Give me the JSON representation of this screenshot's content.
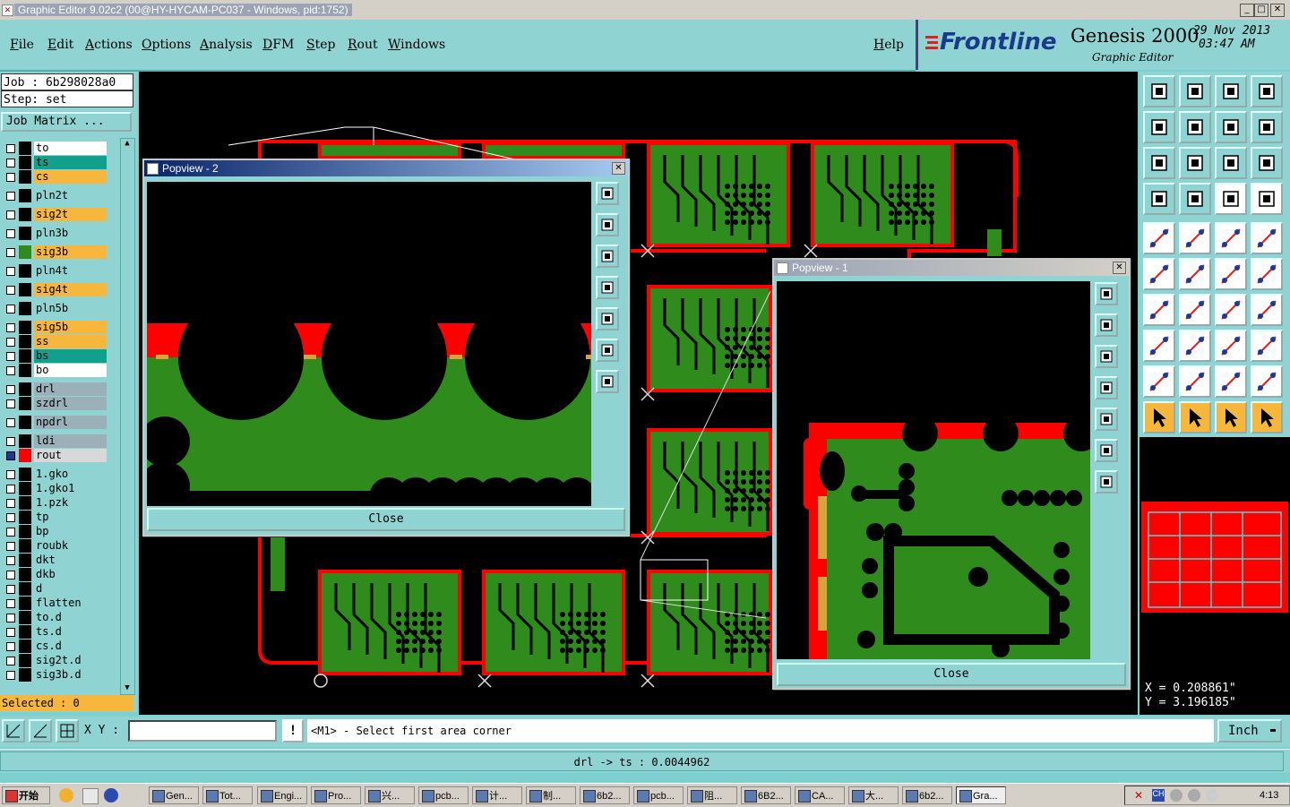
{
  "window": {
    "title": "Graphic Editor 9.02c2 (00@HY-HYCAM-PC037 - Windows, pid:1752)"
  },
  "menu": {
    "items": [
      "File",
      "Edit",
      "Actions",
      "Options",
      "Analysis",
      "DFM",
      "Step",
      "Rout",
      "Windows"
    ],
    "help": "Help"
  },
  "brand": {
    "logo": "Frontline",
    "product": "Genesis 2000",
    "subtitle": "Graphic Editor",
    "date": "29 Nov 2013",
    "time": "03:47 AM"
  },
  "job": {
    "job_label": "Job : 6b298028a0",
    "step_label": "Step: set",
    "matrix_button": "Job Matrix ..."
  },
  "layers": [
    {
      "name": "to",
      "color": "#ffffff"
    },
    {
      "name": "ts",
      "color": "#11a08c"
    },
    {
      "name": "cs",
      "color": "#f6b73c"
    },
    {
      "name": "pln2t",
      "color": "#8fd4d2"
    },
    {
      "name": "sig2t",
      "color": "#f6b73c"
    },
    {
      "name": "pln3b",
      "color": "#8fd4d2"
    },
    {
      "name": "sig3b",
      "color": "#f6b73c"
    },
    {
      "name": "pln4t",
      "color": "#8fd4d2"
    },
    {
      "name": "sig4t",
      "color": "#f6b73c"
    },
    {
      "name": "pln5b",
      "color": "#8fd4d2"
    },
    {
      "name": "sig5b",
      "color": "#f6b73c"
    },
    {
      "name": "ss",
      "color": "#f6b73c"
    },
    {
      "name": "bs",
      "color": "#11a08c"
    },
    {
      "name": "bo",
      "color": "#ffffff"
    },
    {
      "name": "drl",
      "color": "#9bb0b8"
    },
    {
      "name": "szdrl",
      "color": "#9bb0b8"
    },
    {
      "name": "npdrl",
      "color": "#9bb0b8"
    },
    {
      "name": "ldi",
      "color": "#9bb0b8"
    },
    {
      "name": "rout",
      "color": "#d8d8d8"
    },
    {
      "name": "1.gko",
      "color": "#8fd4d2"
    },
    {
      "name": "1.gko1",
      "color": "#8fd4d2"
    },
    {
      "name": "1.pzk",
      "color": "#8fd4d2"
    },
    {
      "name": "tp",
      "color": "#8fd4d2"
    },
    {
      "name": "bp",
      "color": "#8fd4d2"
    },
    {
      "name": "roubk",
      "color": "#8fd4d2"
    },
    {
      "name": "dkt",
      "color": "#8fd4d2"
    },
    {
      "name": "dkb",
      "color": "#8fd4d2"
    },
    {
      "name": "d",
      "color": "#8fd4d2"
    },
    {
      "name": "flatten",
      "color": "#8fd4d2"
    },
    {
      "name": "to.d",
      "color": "#8fd4d2"
    },
    {
      "name": "ts.d",
      "color": "#8fd4d2"
    },
    {
      "name": "cs.d",
      "color": "#8fd4d2"
    },
    {
      "name": "sig2t.d",
      "color": "#8fd4d2"
    },
    {
      "name": "sig3b.d",
      "color": "#8fd4d2"
    }
  ],
  "selected": "Selected : 0",
  "popview2": {
    "title": "Popview - 2",
    "close": "Close"
  },
  "popview1": {
    "title": "Popview - 1",
    "close": "Close"
  },
  "coords": {
    "x": "X = 0.208861\"",
    "y": "Y = 3.196185\""
  },
  "input": {
    "xy_label": "X Y :",
    "value": "",
    "prompt": "<M1> - Select first area corner",
    "units": "Inch"
  },
  "status": "drl -> ts : 0.0044962",
  "taskbar": {
    "start": "开始",
    "tasks": [
      "Gen...",
      "Tot...",
      "Engi...",
      "Pro...",
      "兴...",
      "pcb...",
      "计...",
      "制...",
      "6b2...",
      "pcb...",
      "阻...",
      "6B2...",
      "CA...",
      "大...",
      "6b2...",
      "Gra..."
    ],
    "clock": "4:13"
  },
  "colors": {
    "board_green": "#2e8b1c",
    "copper_red": "#ff0000",
    "panel_cyan": "#8fd4d2"
  }
}
